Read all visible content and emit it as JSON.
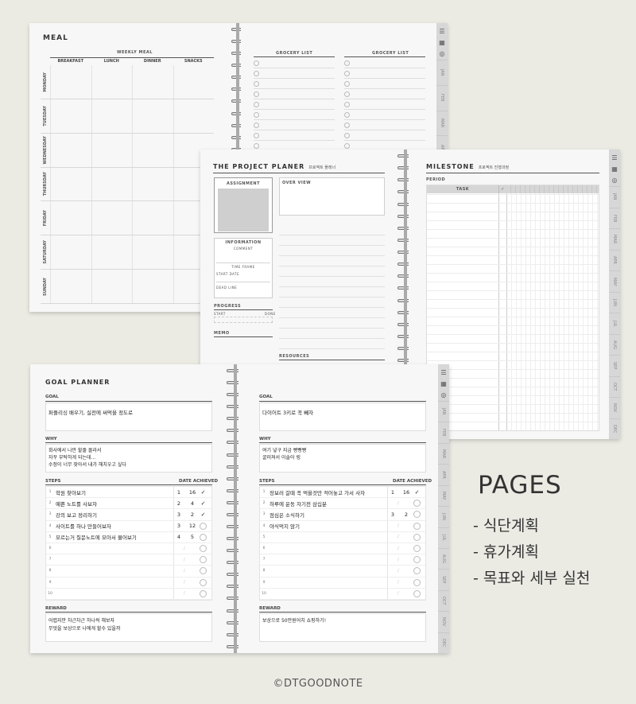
{
  "meal": {
    "title": "MEAL",
    "weekly_meal": "WEEKLY MEAL",
    "columns": [
      "BREAKFAST",
      "LUNCH",
      "DINNER",
      "SNACKS"
    ],
    "days": [
      "MONDAY",
      "TUESDAY",
      "WEDNESDAY",
      "THURSDAY",
      "FRIDAY",
      "SATURDAY",
      "SUNDAY"
    ],
    "grocery_a": "GROCERY LIST",
    "grocery_b": "GROCERY LIST",
    "tab_months": [
      "JAN",
      "FEB",
      "MAR",
      "APR"
    ]
  },
  "project": {
    "title": "THE PROJECT PLANER",
    "title_sub": "프로젝트 플래너",
    "assignment": "ASSIGNMENT",
    "overview": "OVER VIEW",
    "information": "INFORMATION",
    "comment": "COMMENT",
    "time_frame": "TIME FRAME",
    "start_date": "START DATE",
    "dead_line": "DEAD LINE",
    "progress": "PROGRESS",
    "start": "START",
    "done": "DONE",
    "memo": "MEMO",
    "resources": "RESOURCES",
    "milestone": "MILESTONE",
    "milestone_sub": "프로젝트 진행과정",
    "period": "PERIOD",
    "task": "TASK",
    "check": "✓",
    "tab_months": [
      "JAN",
      "FEB",
      "MAR",
      "APR",
      "MAY",
      "JUN",
      "JUL",
      "AUG",
      "SEP",
      "OCT",
      "NOV",
      "DEC"
    ]
  },
  "goal": {
    "title": "GOAL PLANNER",
    "left": {
      "goal_label": "GOAL",
      "goal_text": "퍼플리싱 배우기, 실전에 써먹을 정도로",
      "why_label": "WHY",
      "why_lines": [
        "회사에서 나만 할줄 몰라서",
        "자꾸 부탁하게 되는데...",
        "수정이 너무 잦아서 내가 해치우고 싶다"
      ],
      "steps_label": "STEPS",
      "date_achieved": "DATE ACHIEVED",
      "steps": [
        {
          "n": "1",
          "text": "학원 찾아보기",
          "m": "1",
          "d": "16",
          "done": "✓"
        },
        {
          "n": "2",
          "text": "예쁜 노트를 사보자",
          "m": "2",
          "d": "4",
          "done": "✓"
        },
        {
          "n": "3",
          "text": "강의 보고 정리하기",
          "m": "3",
          "d": "2",
          "done": "✓"
        },
        {
          "n": "4",
          "text": "사이트를 하나 만들어보자",
          "m": "3",
          "d": "12",
          "done": ""
        },
        {
          "n": "5",
          "text": "모르는거 질문노트에 모아서 물어보기",
          "m": "4",
          "d": "5",
          "done": ""
        },
        {
          "n": "6",
          "text": "",
          "m": "",
          "d": "",
          "done": ""
        },
        {
          "n": "7",
          "text": "",
          "m": "",
          "d": "",
          "done": ""
        },
        {
          "n": "8",
          "text": "",
          "m": "",
          "d": "",
          "done": ""
        },
        {
          "n": "9",
          "text": "",
          "m": "",
          "d": "",
          "done": ""
        },
        {
          "n": "10",
          "text": "",
          "m": "",
          "d": "",
          "done": ""
        }
      ],
      "reward_label": "REWARD",
      "reward_lines": [
        "어렵지만 차근차근 하나씩 해보자",
        "무엇을 보상으로 나에게 할수 있을까"
      ]
    },
    "right": {
      "goal_label": "GOAL",
      "goal_text": "다이어트 3키로 꼭 빼자",
      "why_label": "WHY",
      "why_lines": [
        "여기 넣구 지금 빵빵빵",
        "굴러져서 이솔아 링"
      ],
      "steps_label": "STEPS",
      "date_achieved": "DATE ACHIEVED",
      "steps": [
        {
          "n": "1",
          "text": "장보러 갈때 꼭 먹을것만 적어놓고 가서 사자",
          "m": "1",
          "d": "16",
          "done": "✓"
        },
        {
          "n": "2",
          "text": "하루에 운동 자기전 삼십분",
          "m": "",
          "d": "",
          "done": ""
        },
        {
          "n": "3",
          "text": "점심은 소식하기",
          "m": "3",
          "d": "2",
          "done": ""
        },
        {
          "n": "4",
          "text": "야식먹지 않기",
          "m": "",
          "d": "",
          "done": ""
        },
        {
          "n": "5",
          "text": "",
          "m": "",
          "d": "",
          "done": ""
        },
        {
          "n": "6",
          "text": "",
          "m": "",
          "d": "",
          "done": ""
        },
        {
          "n": "7",
          "text": "",
          "m": "",
          "d": "",
          "done": ""
        },
        {
          "n": "8",
          "text": "",
          "m": "",
          "d": "",
          "done": ""
        },
        {
          "n": "9",
          "text": "",
          "m": "",
          "d": "",
          "done": ""
        },
        {
          "n": "10",
          "text": "",
          "m": "",
          "d": "",
          "done": ""
        }
      ],
      "reward_label": "REWARD",
      "reward_lines": [
        "보상으로 50만원어치 쇼핑하기!"
      ]
    },
    "tab_months": [
      "JAN",
      "FEB",
      "MAR",
      "APR",
      "MAY",
      "JUN",
      "JUL",
      "AUG",
      "SEP",
      "OCT",
      "NOV",
      "DEC"
    ]
  },
  "caption": {
    "heading": "PAGES",
    "items": [
      "- 식단계획",
      "- 휴가계획",
      "- 목표와 세부 실천"
    ]
  },
  "brand": "©DTGOODNOTE"
}
